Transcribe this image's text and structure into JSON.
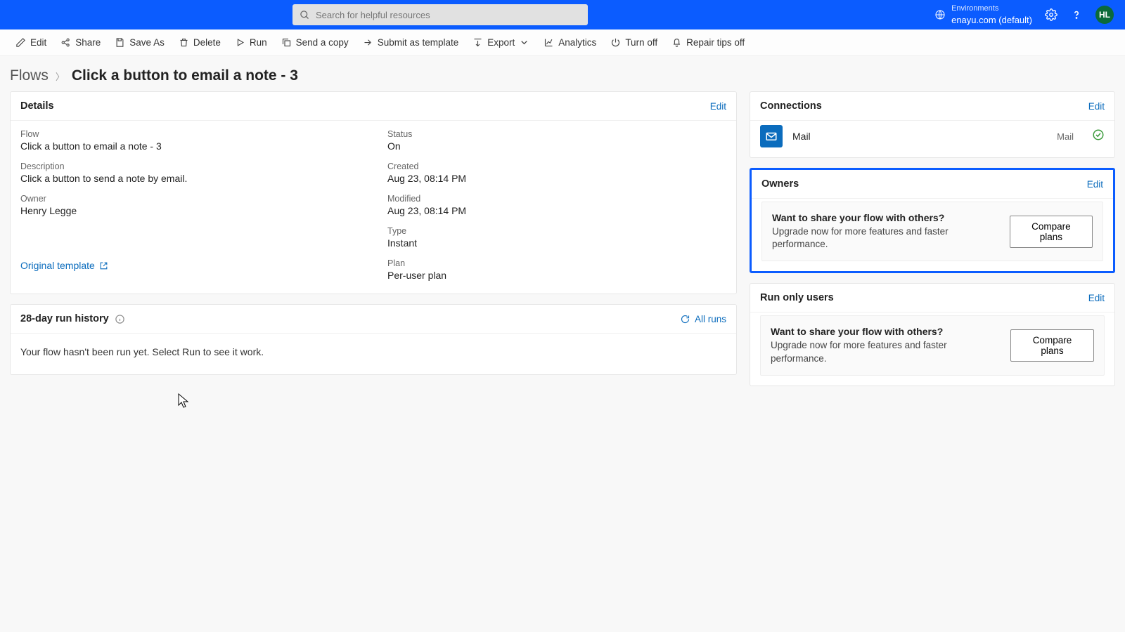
{
  "header": {
    "search_placeholder": "Search for helpful resources",
    "env_label": "Environments",
    "env_name": "enayu.com (default)",
    "avatar_initials": "HL"
  },
  "toolbar": {
    "edit": "Edit",
    "share": "Share",
    "save_as": "Save As",
    "delete": "Delete",
    "run": "Run",
    "send_copy": "Send a copy",
    "submit_template": "Submit as template",
    "export": "Export",
    "analytics": "Analytics",
    "turn_off": "Turn off",
    "repair_tips": "Repair tips off"
  },
  "breadcrumb": {
    "root": "Flows",
    "current": "Click a button to email a note - 3"
  },
  "details": {
    "title": "Details",
    "edit": "Edit",
    "flow_label": "Flow",
    "flow_value": "Click a button to email a note - 3",
    "desc_label": "Description",
    "desc_value": "Click a button to send a note by email.",
    "owner_label": "Owner",
    "owner_value": "Henry Legge",
    "status_label": "Status",
    "status_value": "On",
    "created_label": "Created",
    "created_value": "Aug 23, 08:14 PM",
    "modified_label": "Modified",
    "modified_value": "Aug 23, 08:14 PM",
    "type_label": "Type",
    "type_value": "Instant",
    "plan_label": "Plan",
    "plan_value": "Per-user plan",
    "template_link": "Original template"
  },
  "history": {
    "title": "28-day run history",
    "all_runs": "All runs",
    "empty": "Your flow hasn't been run yet. Select Run to see it work."
  },
  "connections": {
    "title": "Connections",
    "edit": "Edit",
    "item_name": "Mail",
    "item_type": "Mail"
  },
  "owners": {
    "title": "Owners",
    "edit": "Edit",
    "promo_title": "Want to share your flow with others?",
    "promo_body": "Upgrade now for more features and faster performance.",
    "promo_btn": "Compare plans"
  },
  "run_only": {
    "title": "Run only users",
    "edit": "Edit",
    "promo_title": "Want to share your flow with others?",
    "promo_body": "Upgrade now for more features and faster performance.",
    "promo_btn": "Compare plans"
  }
}
